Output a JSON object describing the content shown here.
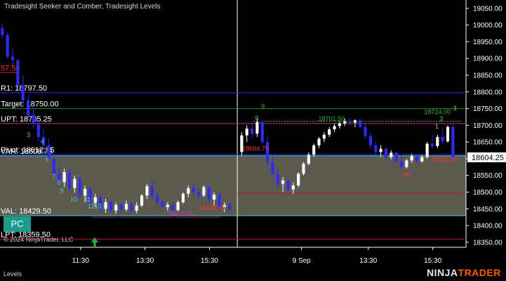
{
  "window": {
    "title": "Tradesight Seeker and Comber, Tradesight Levels",
    "copyright": "© 2024 NinjaTrader, LLC",
    "footer_tab": "Levels",
    "brand_prefix": "NINJA",
    "brand_suffix": "TRADER",
    "pc_badge": "PC"
  },
  "colors": {
    "background": "#000000",
    "up_candle": "#ffffff",
    "down_candle": "#2a2aff",
    "value_area": "#5c5a4e",
    "blue_level": "#2a2aff",
    "green_level": "#1f8a1f",
    "red_level": "#c01818",
    "cyan_level": "#3fd0d0",
    "magenta_level": "#d02a8a",
    "seeker_green": "#2eb82e",
    "seeker_cyan": "#3fd0d0",
    "comber_red": "#ff3030",
    "comber_magenta": "#cc33cc",
    "last_price_bg": "#ffffff"
  },
  "chart_data": {
    "type": "candlestick",
    "y_axis": {
      "ticks": [
        18350,
        18400,
        18450,
        18500,
        18550,
        18600,
        18650,
        18700,
        18750,
        18800,
        18850,
        18900,
        18950,
        19000,
        19050
      ],
      "tick_labels": [
        "18350.00",
        "18400.00",
        "18450.00",
        "18500.00",
        "18550.00",
        "18600.00",
        "18650.00",
        "18700.00",
        "18750.00",
        "18800.00",
        "18850.00",
        "18900.00",
        "18950.00",
        "19000.00",
        "19050.00"
      ],
      "ylim": [
        18335,
        19075
      ]
    },
    "x_axis": {
      "tick_labels": [
        "11:30",
        "13:30",
        "15:30",
        "9 Sep",
        "13:30",
        "15:30"
      ]
    },
    "last_price": "18604.25",
    "levels": [
      {
        "label": "57.50",
        "value": 18857.5,
        "color": "red",
        "extent": "left"
      },
      {
        "label": "R1: 18797.50",
        "value": 18797.5,
        "color": "blue",
        "extent": "full"
      },
      {
        "label": "Target: 18750.00",
        "value": 18750.0,
        "color": "green",
        "extent": "full"
      },
      {
        "label": "UPT: 18705.25",
        "value": 18705.25,
        "color": "magenta",
        "extent": "full"
      },
      {
        "label": "Pivot: 18612.75",
        "value": 18612.75,
        "color": "blue",
        "extent": "full"
      },
      {
        "label": "VAH: 18608.75",
        "value": 18608.75,
        "color": "cyan",
        "extent": "full"
      },
      {
        "label": "VAL: 18429.50",
        "value": 18429.5,
        "color": "cyan",
        "extent": "full"
      },
      {
        "label": "LPT: 18359.50",
        "value": 18359.5,
        "color": "red",
        "extent": "full"
      }
    ],
    "value_area": {
      "high": 18608.75,
      "low": 18429.5
    },
    "annotations": [
      {
        "text": "18701.50",
        "x_fraction": 0.72,
        "value": 18713,
        "color": "green"
      },
      {
        "text": "18724.00",
        "x_fraction": 0.95,
        "value": 18733,
        "color": "green"
      },
      {
        "text": "18604.75",
        "x_fraction": 0.555,
        "value": 18624,
        "color": "red"
      },
      {
        "text": "18611.00",
        "x_fraction": 0.965,
        "value": 18592,
        "color": "red"
      },
      {
        "text": "18443.00",
        "x_fraction": 0.46,
        "value": 18446,
        "color": "red"
      },
      {
        "text": "18451.25",
        "x_fraction": 0.39,
        "value": 18430,
        "color": "magenta"
      },
      {
        "text": "(R)",
        "x_fraction": 0.885,
        "value": 18545,
        "color": "red"
      }
    ],
    "seeker_counts": [
      {
        "text": "3",
        "x_fraction": 0.062,
        "value": 18665,
        "color": "cyan"
      },
      {
        "text": "4",
        "x_fraction": 0.092,
        "value": 18645,
        "color": "cyan"
      },
      {
        "text": "6",
        "x_fraction": 0.103,
        "value": 18592,
        "color": "cyan"
      },
      {
        "text": "7",
        "x_fraction": 0.117,
        "value": 18540,
        "color": "cyan"
      },
      {
        "text": "8",
        "x_fraction": 0.128,
        "value": 18522,
        "color": "cyan"
      },
      {
        "text": "9",
        "x_fraction": 0.134,
        "value": 18498,
        "color": "cyan"
      },
      {
        "text": "10",
        "x_fraction": 0.16,
        "value": 18472,
        "color": "cyan"
      },
      {
        "text": "11",
        "x_fraction": 0.19,
        "value": 18472,
        "color": "cyan"
      },
      {
        "text": "12",
        "x_fraction": 0.198,
        "value": 18452,
        "color": "cyan"
      },
      {
        "text": "13",
        "x_fraction": 0.213,
        "value": 18452,
        "color": "cyan"
      },
      {
        "text": "8",
        "x_fraction": 0.558,
        "value": 18715,
        "color": "green"
      },
      {
        "text": "9",
        "x_fraction": 0.571,
        "value": 18750,
        "color": "green"
      },
      {
        "text": "1",
        "x_fraction": 0.949,
        "value": 18690,
        "color": "cyan"
      },
      {
        "text": "2",
        "x_fraction": 0.959,
        "value": 18712,
        "color": "cyan"
      },
      {
        "text": "3",
        "x_fraction": 0.988,
        "value": 18745,
        "color": "cyan"
      }
    ],
    "sessions": [
      {
        "label": "session-1",
        "start_fraction": 0.0,
        "end_fraction": 0.515
      },
      {
        "label": "session-2",
        "start_fraction": 0.52,
        "end_fraction": 1.0
      }
    ],
    "candles": [
      {
        "o": 18990,
        "h": 19005,
        "l": 18960,
        "c": 18970
      },
      {
        "o": 18970,
        "h": 18978,
        "l": 18900,
        "c": 18905
      },
      {
        "o": 18905,
        "h": 18930,
        "l": 18880,
        "c": 18895
      },
      {
        "o": 18895,
        "h": 18900,
        "l": 18810,
        "c": 18820
      },
      {
        "o": 18820,
        "h": 18850,
        "l": 18760,
        "c": 18775
      },
      {
        "o": 18775,
        "h": 18790,
        "l": 18720,
        "c": 18730
      },
      {
        "o": 18730,
        "h": 18760,
        "l": 18690,
        "c": 18705
      },
      {
        "o": 18705,
        "h": 18720,
        "l": 18650,
        "c": 18665
      },
      {
        "o": 18665,
        "h": 18690,
        "l": 18630,
        "c": 18640
      },
      {
        "o": 18640,
        "h": 18660,
        "l": 18590,
        "c": 18600
      },
      {
        "o": 18600,
        "h": 18620,
        "l": 18545,
        "c": 18555
      },
      {
        "o": 18555,
        "h": 18580,
        "l": 18520,
        "c": 18530
      },
      {
        "o": 18530,
        "h": 18570,
        "l": 18515,
        "c": 18560
      },
      {
        "o": 18560,
        "h": 18570,
        "l": 18505,
        "c": 18512
      },
      {
        "o": 18512,
        "h": 18550,
        "l": 18498,
        "c": 18540
      },
      {
        "o": 18540,
        "h": 18548,
        "l": 18480,
        "c": 18490
      },
      {
        "o": 18490,
        "h": 18520,
        "l": 18470,
        "c": 18510
      },
      {
        "o": 18510,
        "h": 18515,
        "l": 18460,
        "c": 18468
      },
      {
        "o": 18468,
        "h": 18495,
        "l": 18455,
        "c": 18485
      },
      {
        "o": 18485,
        "h": 18490,
        "l": 18440,
        "c": 18450
      },
      {
        "o": 18450,
        "h": 18480,
        "l": 18438,
        "c": 18470
      },
      {
        "o": 18470,
        "h": 18478,
        "l": 18440,
        "c": 18445
      },
      {
        "o": 18445,
        "h": 18470,
        "l": 18435,
        "c": 18462
      },
      {
        "o": 18462,
        "h": 18468,
        "l": 18440,
        "c": 18448
      },
      {
        "o": 18448,
        "h": 18475,
        "l": 18442,
        "c": 18465
      },
      {
        "o": 18465,
        "h": 18470,
        "l": 18438,
        "c": 18444
      },
      {
        "o": 18444,
        "h": 18470,
        "l": 18436,
        "c": 18460
      },
      {
        "o": 18460,
        "h": 18495,
        "l": 18455,
        "c": 18490
      },
      {
        "o": 18490,
        "h": 18525,
        "l": 18480,
        "c": 18518
      },
      {
        "o": 18518,
        "h": 18535,
        "l": 18480,
        "c": 18488
      },
      {
        "o": 18488,
        "h": 18500,
        "l": 18460,
        "c": 18470
      },
      {
        "o": 18470,
        "h": 18478,
        "l": 18450,
        "c": 18455
      },
      {
        "o": 18455,
        "h": 18470,
        "l": 18445,
        "c": 18462
      },
      {
        "o": 18462,
        "h": 18470,
        "l": 18440,
        "c": 18446
      },
      {
        "o": 18446,
        "h": 18475,
        "l": 18442,
        "c": 18470
      },
      {
        "o": 18470,
        "h": 18500,
        "l": 18465,
        "c": 18495
      },
      {
        "o": 18495,
        "h": 18520,
        "l": 18485,
        "c": 18512
      },
      {
        "o": 18512,
        "h": 18525,
        "l": 18490,
        "c": 18500
      },
      {
        "o": 18500,
        "h": 18515,
        "l": 18480,
        "c": 18490
      },
      {
        "o": 18490,
        "h": 18520,
        "l": 18485,
        "c": 18515
      },
      {
        "o": 18515,
        "h": 18518,
        "l": 18470,
        "c": 18478
      },
      {
        "o": 18478,
        "h": 18500,
        "l": 18460,
        "c": 18492
      },
      {
        "o": 18492,
        "h": 18500,
        "l": 18448,
        "c": 18455
      },
      {
        "o": 18455,
        "h": 18470,
        "l": 18440,
        "c": 18462
      },
      {
        "o": 18462,
        "h": 18468,
        "l": 18442,
        "c": 18448
      },
      {
        "o": 18620,
        "h": 18680,
        "l": 18610,
        "c": 18670
      },
      {
        "o": 18670,
        "h": 18700,
        "l": 18650,
        "c": 18690
      },
      {
        "o": 18690,
        "h": 18710,
        "l": 18660,
        "c": 18675
      },
      {
        "o": 18675,
        "h": 18720,
        "l": 18665,
        "c": 18710
      },
      {
        "o": 18710,
        "h": 18715,
        "l": 18640,
        "c": 18650
      },
      {
        "o": 18650,
        "h": 18670,
        "l": 18580,
        "c": 18590
      },
      {
        "o": 18590,
        "h": 18610,
        "l": 18540,
        "c": 18555
      },
      {
        "o": 18555,
        "h": 18570,
        "l": 18510,
        "c": 18525
      },
      {
        "o": 18525,
        "h": 18545,
        "l": 18500,
        "c": 18535
      },
      {
        "o": 18535,
        "h": 18540,
        "l": 18500,
        "c": 18508
      },
      {
        "o": 18508,
        "h": 18530,
        "l": 18495,
        "c": 18520
      },
      {
        "o": 18520,
        "h": 18560,
        "l": 18515,
        "c": 18555
      },
      {
        "o": 18555,
        "h": 18590,
        "l": 18550,
        "c": 18585
      },
      {
        "o": 18585,
        "h": 18620,
        "l": 18580,
        "c": 18612
      },
      {
        "o": 18612,
        "h": 18645,
        "l": 18605,
        "c": 18640
      },
      {
        "o": 18640,
        "h": 18665,
        "l": 18632,
        "c": 18660
      },
      {
        "o": 18660,
        "h": 18680,
        "l": 18650,
        "c": 18672
      },
      {
        "o": 18672,
        "h": 18695,
        "l": 18665,
        "c": 18688
      },
      {
        "o": 18688,
        "h": 18705,
        "l": 18680,
        "c": 18698
      },
      {
        "o": 18698,
        "h": 18712,
        "l": 18690,
        "c": 18706
      },
      {
        "o": 18706,
        "h": 18720,
        "l": 18698,
        "c": 18712
      },
      {
        "o": 18712,
        "h": 18722,
        "l": 18700,
        "c": 18708
      },
      {
        "o": 18708,
        "h": 18718,
        "l": 18695,
        "c": 18715
      },
      {
        "o": 18715,
        "h": 18720,
        "l": 18690,
        "c": 18695
      },
      {
        "o": 18695,
        "h": 18705,
        "l": 18660,
        "c": 18668
      },
      {
        "o": 18668,
        "h": 18680,
        "l": 18630,
        "c": 18640
      },
      {
        "o": 18640,
        "h": 18650,
        "l": 18610,
        "c": 18620
      },
      {
        "o": 18620,
        "h": 18640,
        "l": 18605,
        "c": 18630
      },
      {
        "o": 18630,
        "h": 18635,
        "l": 18595,
        "c": 18605
      },
      {
        "o": 18605,
        "h": 18625,
        "l": 18598,
        "c": 18618
      },
      {
        "o": 18618,
        "h": 18622,
        "l": 18585,
        "c": 18592
      },
      {
        "o": 18592,
        "h": 18610,
        "l": 18568,
        "c": 18575
      },
      {
        "o": 18575,
        "h": 18600,
        "l": 18570,
        "c": 18595
      },
      {
        "o": 18595,
        "h": 18615,
        "l": 18588,
        "c": 18608
      },
      {
        "o": 18608,
        "h": 18612,
        "l": 18585,
        "c": 18592
      },
      {
        "o": 18592,
        "h": 18612,
        "l": 18588,
        "c": 18605
      },
      {
        "o": 18605,
        "h": 18650,
        "l": 18600,
        "c": 18645
      },
      {
        "o": 18645,
        "h": 18670,
        "l": 18630,
        "c": 18638
      },
      {
        "o": 18638,
        "h": 18672,
        "l": 18632,
        "c": 18665
      },
      {
        "o": 18665,
        "h": 18690,
        "l": 18645,
        "c": 18652
      },
      {
        "o": 18652,
        "h": 18700,
        "l": 18648,
        "c": 18695
      },
      {
        "o": 18695,
        "h": 18702,
        "l": 18595,
        "c": 18604
      }
    ]
  }
}
